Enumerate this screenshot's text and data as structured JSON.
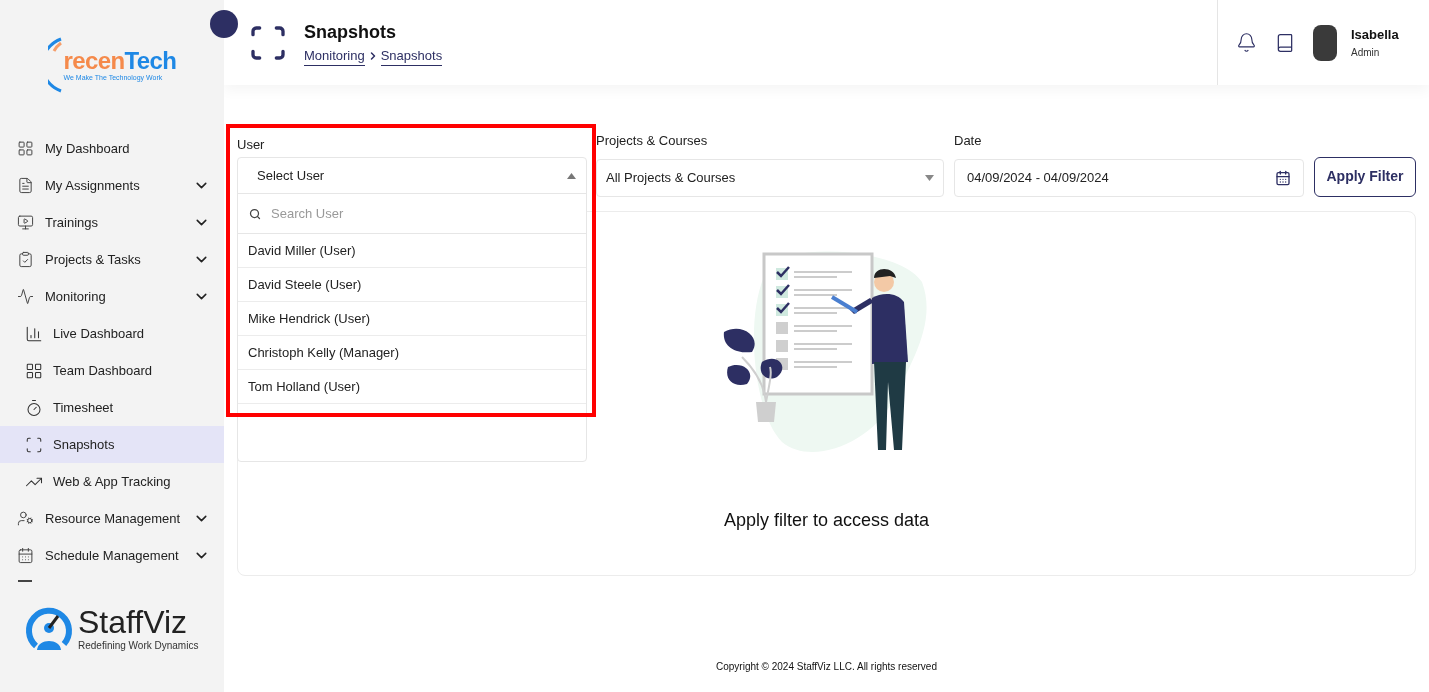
{
  "sidebar": {
    "logo": {
      "name_lead": "recen",
      "name_rest": "Tech",
      "tagline": "We Make The Technology Work"
    },
    "items": [
      {
        "label": "My Dashboard",
        "kind": "link",
        "selected": false
      },
      {
        "label": "My Assignments",
        "kind": "group",
        "selected": false
      },
      {
        "label": "Trainings",
        "kind": "group",
        "selected": false
      },
      {
        "label": "Projects & Tasks",
        "kind": "group",
        "selected": false
      },
      {
        "label": "Monitoring",
        "kind": "group",
        "selected": false,
        "children": [
          {
            "label": "Live Dashboard",
            "selected": false
          },
          {
            "label": "Team Dashboard",
            "selected": false
          },
          {
            "label": "Timesheet",
            "selected": false
          },
          {
            "label": "Snapshots",
            "selected": true
          },
          {
            "label": "Web & App Tracking",
            "selected": false
          }
        ]
      },
      {
        "label": "Resource Management",
        "kind": "group",
        "selected": false
      },
      {
        "label": "Schedule Management",
        "kind": "group",
        "selected": false
      }
    ],
    "brand": {
      "name": "StaffViz",
      "tagline": "Redefining Work Dynamics"
    }
  },
  "header": {
    "title": "Snapshots",
    "breadcrumb": [
      "Monitoring",
      "Snapshots"
    ],
    "user": {
      "name": "Isabella",
      "role": "Admin"
    }
  },
  "filters": {
    "user": {
      "label": "User",
      "value": "Select User",
      "expanded": true,
      "search_placeholder": "Search User",
      "options": [
        "David Miller (User)",
        "David Steele (User)",
        "Mike Hendrick (User)",
        "Christoph Kelly (Manager)",
        "Tom Holland (User)"
      ]
    },
    "projects": {
      "label": "Projects & Courses",
      "value": "All Projects & Courses"
    },
    "date": {
      "label": "Date",
      "value": "04/09/2024 - 04/09/2024"
    },
    "apply_button": "Apply Filter"
  },
  "empty_state": {
    "message": "Apply filter to access data"
  },
  "footer": {
    "copyright": "Copyright © 2024 StaffViz LLC. All rights reserved"
  }
}
